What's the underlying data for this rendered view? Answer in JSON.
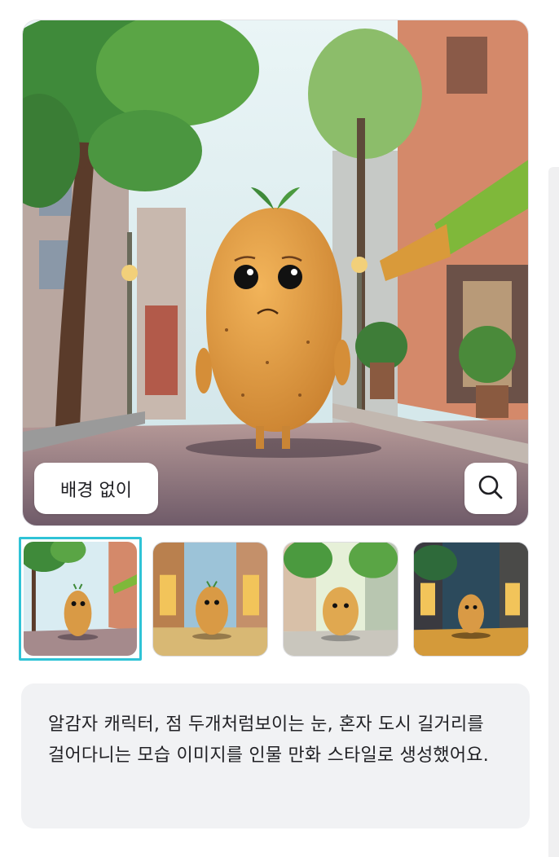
{
  "image": {
    "background_toggle_label": "배경 없이",
    "zoom_icon": "search-icon"
  },
  "thumbnails": [
    {
      "label": "variant-1",
      "selected": true,
      "sky": "#d9ecf2",
      "ground": "#a58a8c"
    },
    {
      "label": "variant-2",
      "selected": false,
      "sky": "#9cc3d8",
      "ground": "#d8b874"
    },
    {
      "label": "variant-3",
      "selected": false,
      "sky": "#e6f0d8",
      "ground": "#c9c6bd"
    },
    {
      "label": "variant-4",
      "selected": false,
      "sky": "#2c4a5c",
      "ground": "#d49a3a"
    }
  ],
  "caption": {
    "text": "알감자 캐릭터, 점 두개처럼보이는 눈, 혼자 도시 길거리를 걸어다니는 모습 이미지를 인물 만화 스타일로 생성했어요."
  },
  "colors": {
    "selected_border": "#2fc3d6",
    "caption_bg": "#f1f2f4"
  }
}
